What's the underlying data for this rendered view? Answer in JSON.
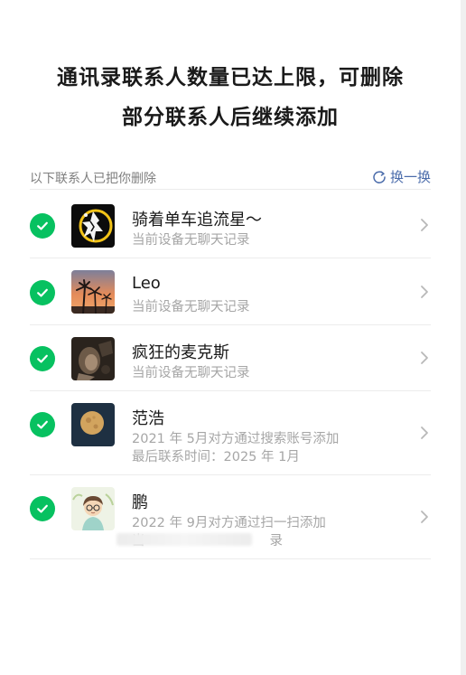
{
  "header": {
    "title_line1": "通讯录联系人数量已达上限，可删除",
    "title_line2": "部分联系人后继续添加"
  },
  "section": {
    "label": "以下联系人已把你删除",
    "refresh_label": "换一换"
  },
  "contacts": [
    {
      "name": "骑着单车追流星～",
      "line1": "当前设备无聊天记录",
      "line2": "",
      "checked": true,
      "avatar": "astrology-avatar"
    },
    {
      "name": "Leo",
      "line1": "当前设备无聊天记录",
      "line2": "",
      "checked": true,
      "avatar": "palm-sunset-avatar"
    },
    {
      "name": "疯狂的麦克斯",
      "line1": "当前设备无聊天记录",
      "line2": "",
      "checked": true,
      "avatar": "dark-photo-avatar"
    },
    {
      "name": "范浩",
      "line1": "2021 年 5月对方通过搜索账号添加",
      "line2": "最后联系时间：2025 年 1月",
      "checked": true,
      "avatar": "moon-avatar"
    },
    {
      "name": "鹏",
      "line1": "2022 年 9月对方通过扫一扫添加",
      "line2": "当",
      "line2_tail": "录",
      "checked": true,
      "avatar": "cartoon-boy-avatar"
    }
  ],
  "colors": {
    "accent_green": "#07c160",
    "link_blue": "#4b6cab",
    "sub_text": "#a6a6a6"
  }
}
